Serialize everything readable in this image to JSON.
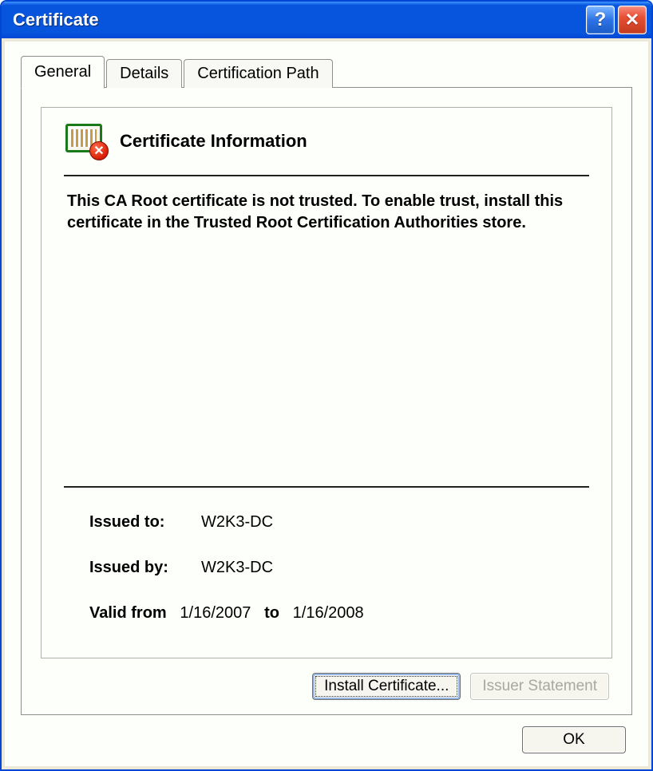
{
  "window": {
    "title": "Certificate"
  },
  "tabs": [
    {
      "label": "General",
      "active": true
    },
    {
      "label": "Details",
      "active": false
    },
    {
      "label": "Certification Path",
      "active": false
    }
  ],
  "cert_info": {
    "heading": "Certificate Information",
    "trust_message": "This CA Root certificate is not trusted. To enable trust, install this certificate in the Trusted Root Certification Authorities store.",
    "issued_to_label": "Issued to:",
    "issued_to_value": "W2K3-DC",
    "issued_by_label": "Issued by:",
    "issued_by_value": "W2K3-DC",
    "valid_from_label": "Valid from",
    "valid_from_value": "1/16/2007",
    "valid_to_label": "to",
    "valid_to_value": "1/16/2008"
  },
  "buttons": {
    "install": "Install Certificate...",
    "issuer_statement": "Issuer Statement",
    "ok": "OK"
  }
}
